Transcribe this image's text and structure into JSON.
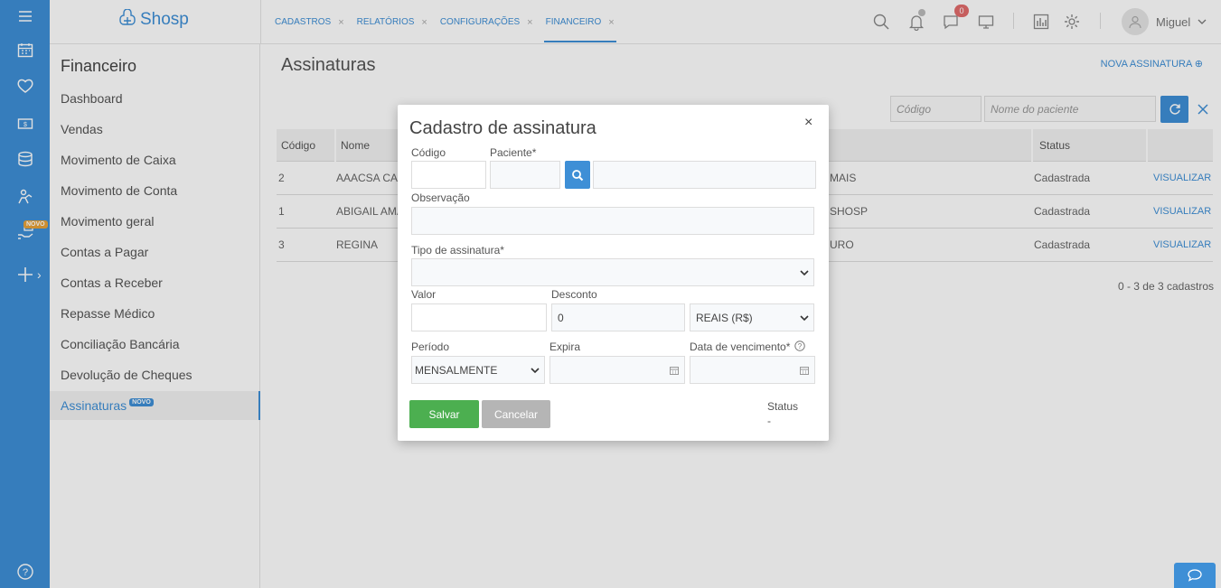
{
  "app": {
    "logo_text": "Shosp"
  },
  "rail": {
    "novo_badge": "NOVO"
  },
  "tabs": [
    {
      "label": "CADASTROS",
      "close": "×"
    },
    {
      "label": "RELATÓRIOS",
      "close": "×"
    },
    {
      "label": "CONFIGURAÇÕES",
      "close": "×"
    },
    {
      "label": "FINANCEIRO",
      "close": "×"
    }
  ],
  "header": {
    "messages_count": "0",
    "user_name": "Miguel"
  },
  "sidebar": {
    "title": "Financeiro",
    "items": [
      {
        "label": "Dashboard"
      },
      {
        "label": "Vendas"
      },
      {
        "label": "Movimento de Caixa"
      },
      {
        "label": "Movimento de Conta"
      },
      {
        "label": "Movimento geral"
      },
      {
        "label": "Contas a Pagar"
      },
      {
        "label": "Contas a Receber"
      },
      {
        "label": "Repasse Médico"
      },
      {
        "label": "Conciliação Bancária"
      },
      {
        "label": "Devolução de Cheques"
      },
      {
        "label": "Assinaturas",
        "badge": "NOVO"
      }
    ]
  },
  "main": {
    "title": "Assinaturas",
    "new_button": "NOVA ASSINATURA ⊕",
    "filters": {
      "code_placeholder": "Código",
      "patient_placeholder": "Nome do paciente"
    },
    "table": {
      "headers": {
        "code": "Código",
        "name": "Nome",
        "status": "Status"
      },
      "rows": [
        {
          "code": "2",
          "name": "AAACSA CAR",
          "plan": "MAIS",
          "status": "Cadastrada",
          "action": "VISUALIZAR"
        },
        {
          "code": "1",
          "name": "ABIGAIL AMA",
          "plan": "SHOSP",
          "status": "Cadastrada",
          "action": "VISUALIZAR"
        },
        {
          "code": "3",
          "name": "REGINA",
          "plan": "URO",
          "status": "Cadastrada",
          "action": "VISUALIZAR"
        }
      ]
    },
    "pager": "0 - 3 de 3 cadastros"
  },
  "modal": {
    "title": "Cadastro de assinatura",
    "close": "×",
    "labels": {
      "code": "Código",
      "patient": "Paciente*",
      "observation": "Observação",
      "type": "Tipo de assinatura*",
      "value": "Valor",
      "discount": "Desconto",
      "period": "Período",
      "expires": "Expira",
      "due_date": "Data de vencimento*",
      "status": "Status"
    },
    "values": {
      "code": "",
      "patient_code": "",
      "patient_name": "",
      "observation": "",
      "type": "",
      "value": "",
      "discount": "0",
      "currency": "REAIS (R$)",
      "period": "MENSALMENTE",
      "expires": "",
      "due_date": "",
      "status": "-"
    },
    "buttons": {
      "save": "Salvar",
      "cancel": "Cancelar"
    }
  }
}
